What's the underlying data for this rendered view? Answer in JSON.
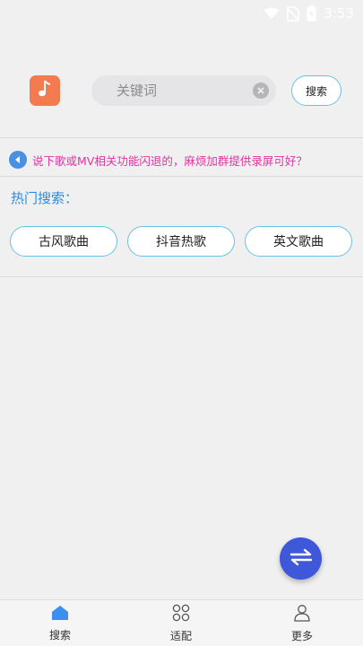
{
  "status_bar": {
    "time": "3:53",
    "icons": [
      "wifi-icon",
      "no-sim-icon",
      "battery-charging-icon"
    ]
  },
  "header": {
    "logo_icon": "music-note-icon",
    "search": {
      "placeholder": "关键词",
      "value": ""
    },
    "search_button_label": "搜索"
  },
  "notice": {
    "icon": "speaker-icon",
    "text": "说下歌或MV相关功能闪退的，麻烦加群提供录屏可好？"
  },
  "hot_search": {
    "title": "热门搜索：",
    "tags": [
      "古风歌曲",
      "抖音热歌",
      "英文歌曲"
    ]
  },
  "fab": {
    "icon": "swap-arrows-icon"
  },
  "bottom_nav": {
    "items": [
      {
        "label": "搜索",
        "icon": "home-search-icon",
        "active": true
      },
      {
        "label": "适配",
        "icon": "grid-icon",
        "active": false
      },
      {
        "label": "更多",
        "icon": "user-icon",
        "active": false
      }
    ]
  },
  "colors": {
    "accent_blue": "#2b8be0",
    "border_blue": "#66c3e8",
    "notice_pink": "#e0359f",
    "logo_orange": "#f47a4f",
    "fab_blue": "#3f58d9"
  }
}
